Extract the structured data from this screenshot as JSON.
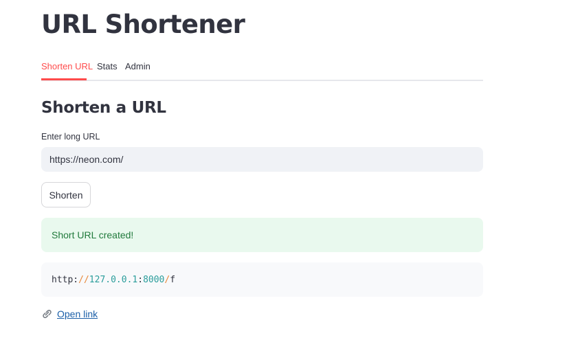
{
  "app": {
    "title": "URL Shortener"
  },
  "tabs": [
    {
      "label": "Shorten URL",
      "active": true
    },
    {
      "label": "Stats",
      "active": false
    },
    {
      "label": "Admin",
      "active": false
    }
  ],
  "shorten": {
    "heading": "Shorten a URL",
    "input_label": "Enter long URL",
    "input_value": "https://neon.com/",
    "button_label": "Shorten"
  },
  "alert": {
    "message": "Short URL created!"
  },
  "result": {
    "code_parts": {
      "scheme": "http:",
      "slashes": "//",
      "host": "127.0.0.1",
      "colon": ":",
      "port": "8000",
      "slash": "/",
      "path": "f"
    }
  },
  "link": {
    "icon": "link-icon",
    "label": "Open link"
  },
  "colors": {
    "accent": "#ff4b4b",
    "success_bg": "#e9f9ee",
    "success_text": "#217a3c",
    "link": "#1b5fa8",
    "code_url": "#2a9d9b",
    "code_punct": "#e8883a"
  }
}
